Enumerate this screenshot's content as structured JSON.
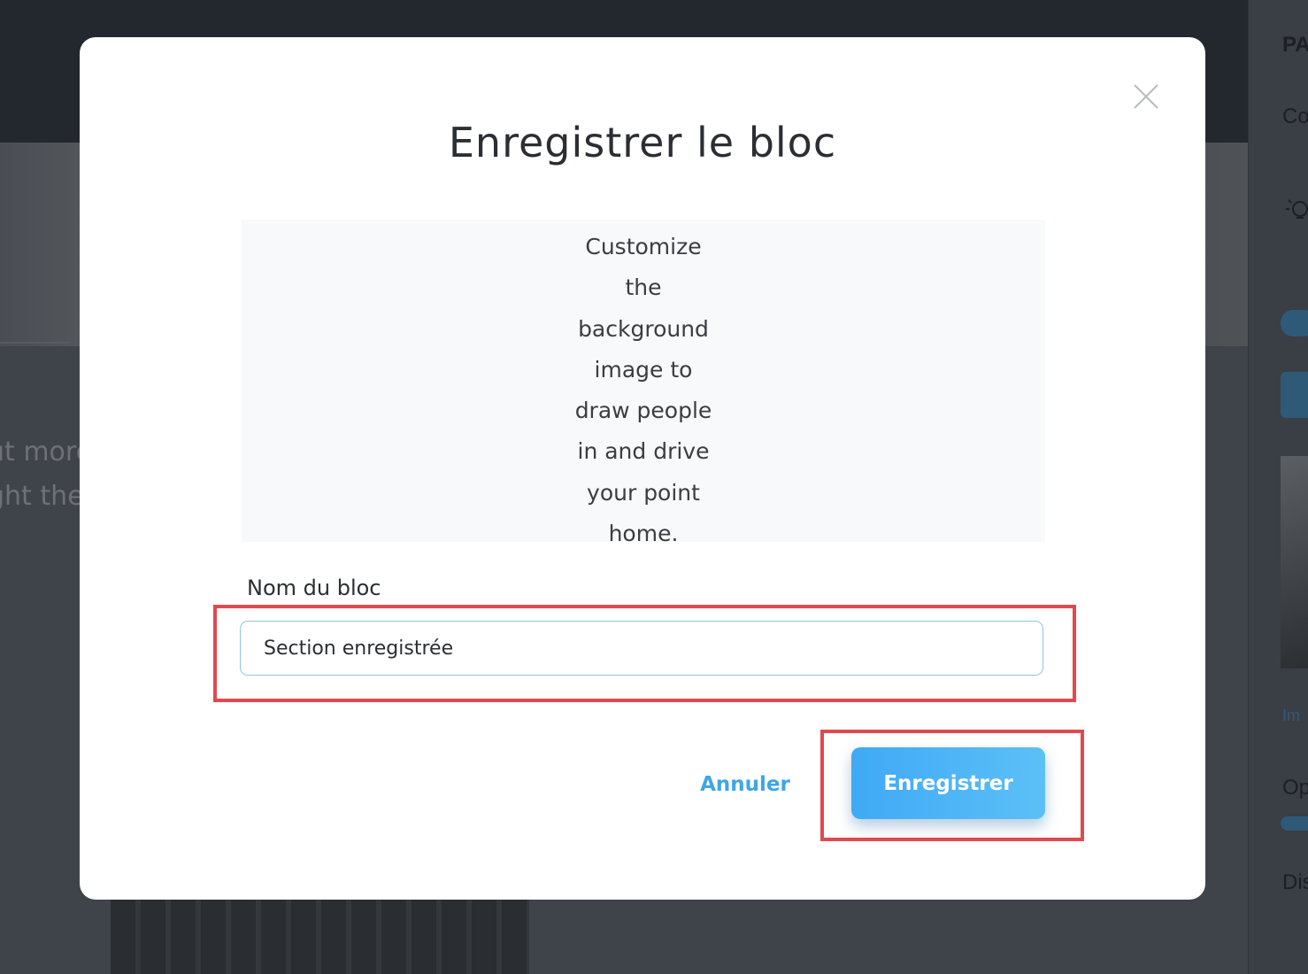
{
  "background": {
    "text_line_1": "ut more",
    "text_line_2": "ght the",
    "sidebar": {
      "label_1": "PA",
      "label_2": "Co",
      "label_3": "Im",
      "label_4": "Op",
      "label_5": "Dis"
    }
  },
  "modal": {
    "title": "Enregistrer le bloc",
    "preview_text": "Customize\nthe\nbackground\nimage to\ndraw people\nin and drive\nyour point\nhome.",
    "field_label": "Nom du bloc",
    "field_value": "Section enregistrée",
    "cancel_label": "Annuler",
    "save_label": "Enregistrer"
  },
  "colors": {
    "accent": "#3ea6e8",
    "highlight": "#e1484f",
    "overlay": "#3b3f46"
  },
  "icons": [
    "close-icon",
    "lightbulb-icon"
  ]
}
